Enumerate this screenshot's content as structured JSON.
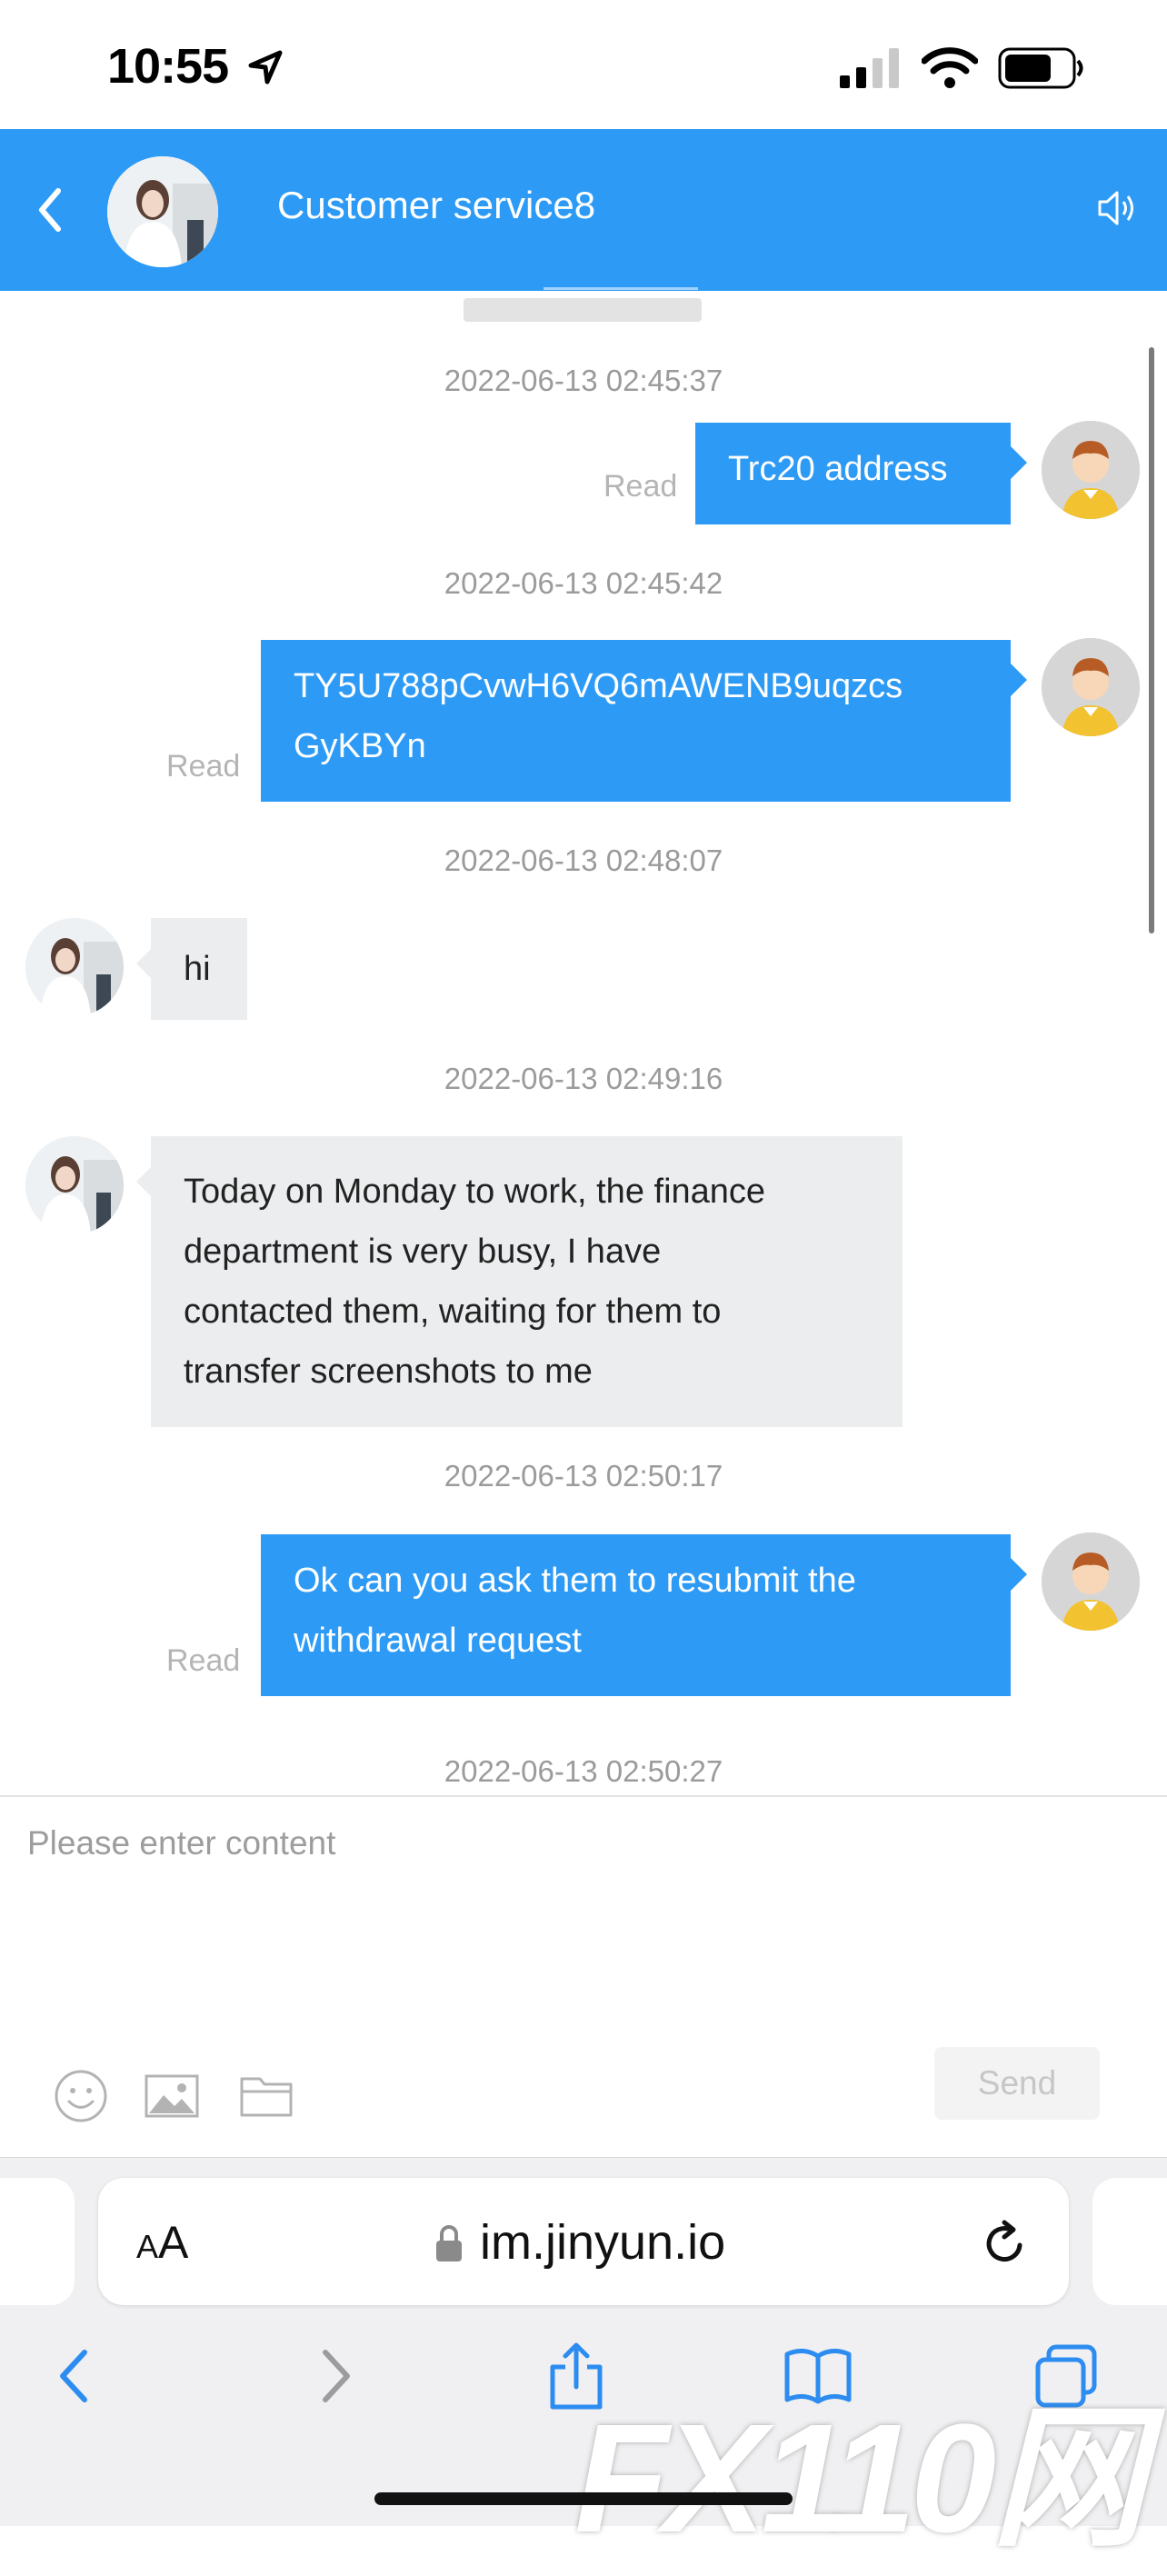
{
  "status_bar": {
    "time": "10:55"
  },
  "header": {
    "back_label": "back",
    "title": "Customer service8"
  },
  "messages": [
    {
      "time": "2022-06-13 02:45:37",
      "direction": "out",
      "text": "Trc20 address",
      "status": "Read"
    },
    {
      "time": "2022-06-13 02:45:42",
      "direction": "out",
      "text": "TY5U788pCvwH6VQ6mAWENB9uqzcs\nGyKBYn",
      "status": "Read"
    },
    {
      "time": "2022-06-13 02:48:07",
      "direction": "in",
      "text": "hi"
    },
    {
      "time": "2022-06-13 02:49:16",
      "direction": "in",
      "text": "Today on Monday to work, the finance\ndepartment is very busy, I have\ncontacted them, waiting for them to\ntransfer screenshots to me"
    },
    {
      "time": "2022-06-13 02:50:17",
      "direction": "out",
      "text": "Ok can you ask them to resubmit the\nwithdrawal request",
      "status": "Read"
    },
    {
      "time": "2022-06-13 02:50:27"
    }
  ],
  "composer": {
    "placeholder": "Please enter content",
    "send_label": "Send",
    "tools": [
      "emoji-icon",
      "image-icon",
      "folder-icon"
    ]
  },
  "browser": {
    "aa_label_small": "A",
    "aa_label_big": "A",
    "url": "im.jinyun.io"
  },
  "watermark": "FX110网",
  "colors": {
    "accent": "#2d9bf6",
    "incoming_bubble": "#ebedee"
  }
}
